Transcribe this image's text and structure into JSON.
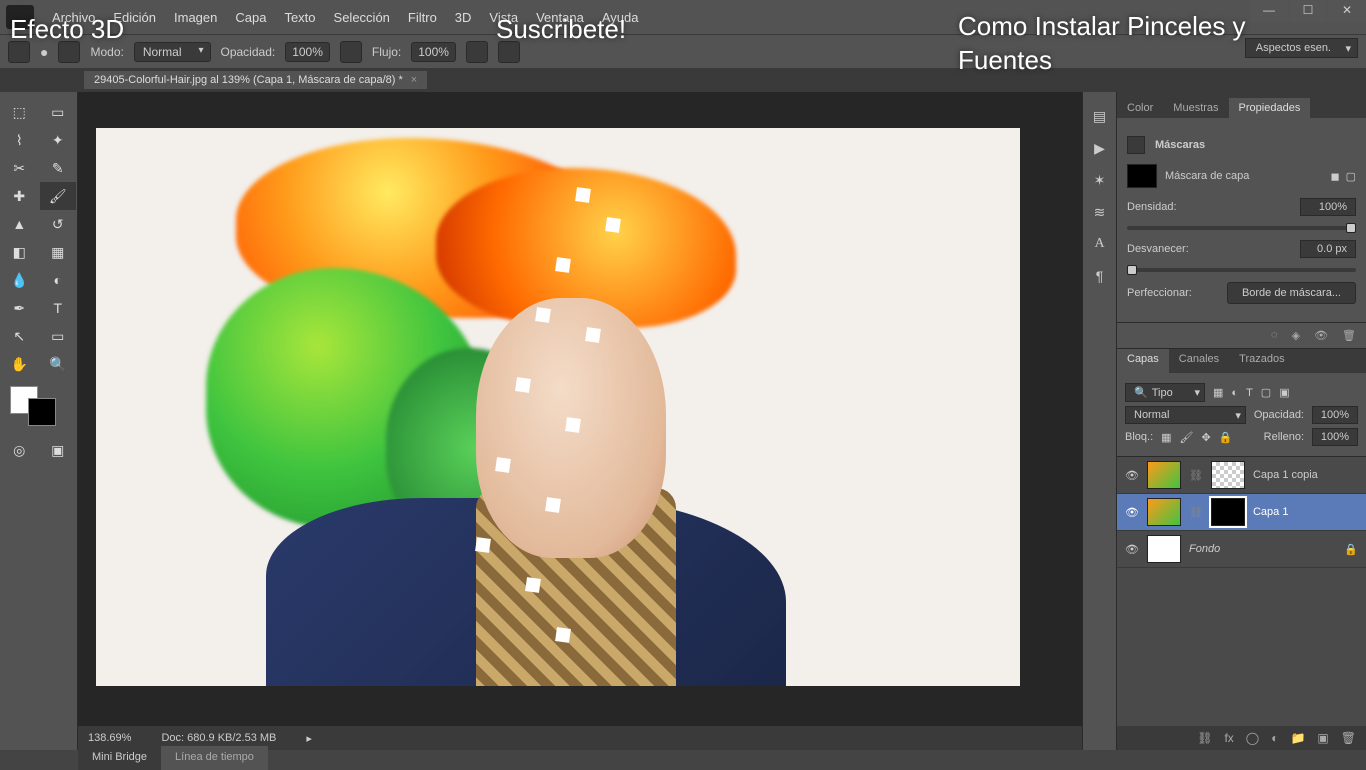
{
  "overlay": {
    "left": "Efecto 3D",
    "center": "Suscribete!",
    "right": "Como Instalar Pinceles y Fuentes"
  },
  "menu": {
    "items": [
      "Archivo",
      "Edición",
      "Imagen",
      "Capa",
      "Texto",
      "Selección",
      "Filtro",
      "3D",
      "Vista",
      "Ventana",
      "Ayuda"
    ]
  },
  "optbar": {
    "mode_label": "Modo:",
    "mode_value": "Normal",
    "opacity_label": "Opacidad:",
    "opacity_value": "100%",
    "flow_label": "Flujo:",
    "flow_value": "100%"
  },
  "workspace": "Aspectos esen.",
  "doc": {
    "title": "29405-Colorful-Hair.jpg al 139% (Capa 1, Máscara de capa/8) *"
  },
  "status": {
    "zoom": "138.69%",
    "doc": "Doc: 680.9 KB/2.53 MB"
  },
  "bottomtabs": {
    "a": "Mini Bridge",
    "b": "Línea de tiempo"
  },
  "panels": {
    "top_tabs": {
      "a": "Color",
      "b": "Muestras",
      "c": "Propiedades"
    },
    "masks_title": "Máscaras",
    "mask_type": "Máscara de capa",
    "density_label": "Densidad:",
    "density_value": "100%",
    "feather_label": "Desvanecer:",
    "feather_value": "0.0 px",
    "refine_label": "Perfeccionar:",
    "refine_btn": "Borde de máscara..."
  },
  "layers": {
    "tabs": {
      "a": "Capas",
      "b": "Canales",
      "c": "Trazados"
    },
    "filter": "Tipo",
    "blend": "Normal",
    "opacity_label": "Opacidad:",
    "opacity_value": "100%",
    "lock_label": "Bloq.:",
    "fill_label": "Relleno:",
    "fill_value": "100%",
    "items": [
      {
        "name": "Capa 1 copia"
      },
      {
        "name": "Capa 1"
      },
      {
        "name": "Fondo"
      }
    ]
  }
}
